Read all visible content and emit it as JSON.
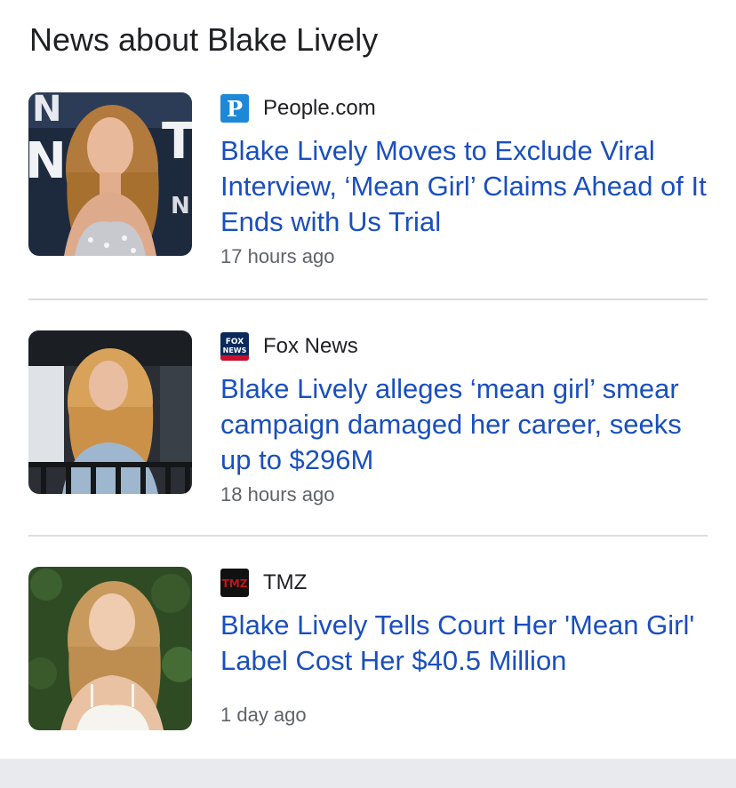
{
  "section": {
    "title": "News about Blake Lively"
  },
  "articles": [
    {
      "source": "People.com",
      "source_logo": "people-logo",
      "logo_letter": "P",
      "headline": "Blake Lively Moves to Exclude Viral Interview, ‘Mean Girl’ Claims Ahead of It Ends with Us Trial",
      "time": "17 hours ago",
      "thumbnail": "blake-lively-red-carpet-photo"
    },
    {
      "source": "Fox News",
      "source_logo": "fox-news-logo",
      "logo_text": "FOX NEWS",
      "headline": "Blake Lively alleges ‘mean girl’ smear campaign damaged her career, seeks up to $296M",
      "time": "18 hours ago",
      "thumbnail": "blake-lively-street-photo"
    },
    {
      "source": "TMZ",
      "source_logo": "tmz-logo",
      "logo_text": "TMZ",
      "headline": "Blake Lively Tells Court Her 'Mean Girl' Label Cost Her $40.5 Million",
      "time": "1 day ago",
      "thumbnail": "blake-lively-garden-photo"
    }
  ],
  "colors": {
    "headline_link": "#1a4fbf",
    "source_text": "#202124",
    "meta_text": "#5f6368",
    "divider": "#dadce0",
    "people_blue": "#1e88d8",
    "tmz_red": "#c0161b"
  }
}
